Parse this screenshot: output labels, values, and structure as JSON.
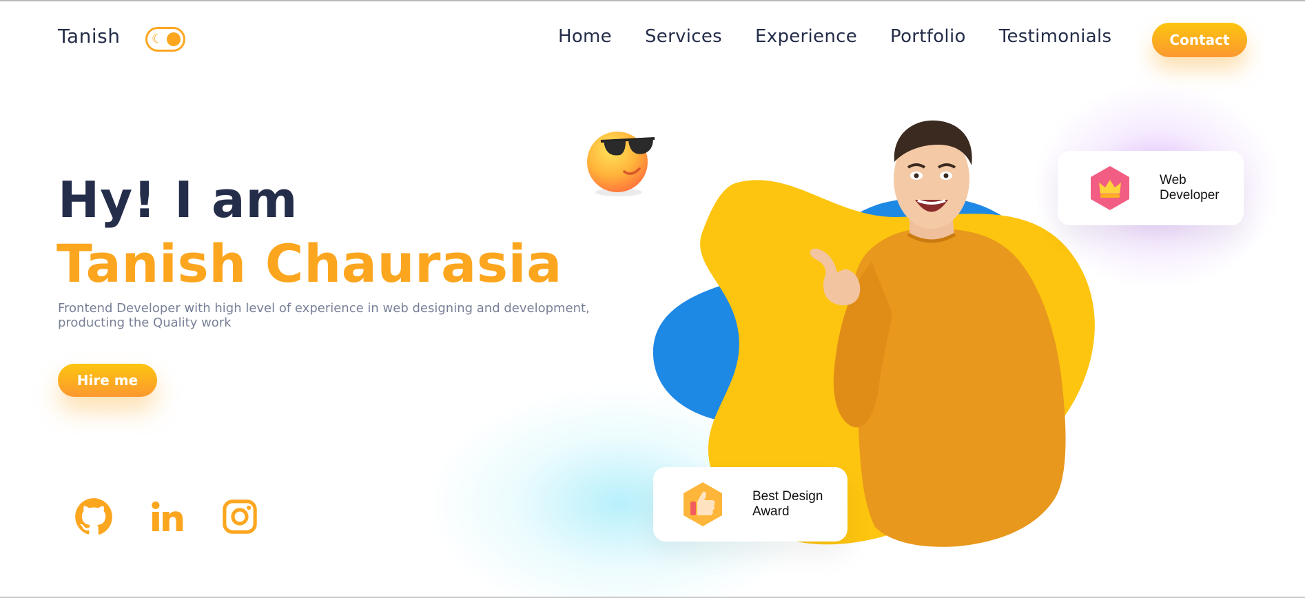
{
  "nav": {
    "brand": "Tanish",
    "links": [
      "Home",
      "Services",
      "Experience",
      "Portfolio",
      "Testimonials"
    ],
    "contact_label": "Contact"
  },
  "hero": {
    "greeting": "Hy! I am",
    "name": "Tanish Chaurasia",
    "description": "Frontend Developer with high level of experience in web designing and development, producting the Quality work",
    "hire_label": "Hire me"
  },
  "cards": {
    "web_developer": "Web Developer",
    "best_design_award": "Best Design Award"
  },
  "icons": {
    "toggle": "moon-icon",
    "socials": [
      "github-icon",
      "linkedin-icon",
      "instagram-icon"
    ],
    "emoji": "sunglasses-emoji-icon",
    "web_badge": "crown-icon",
    "award_badge": "thumbs-up-icon"
  },
  "colors": {
    "accent": "#fca61f",
    "dark_text": "#242d49",
    "blob_yellow": "#fdc50f",
    "blob_blue": "#1e88e5"
  }
}
